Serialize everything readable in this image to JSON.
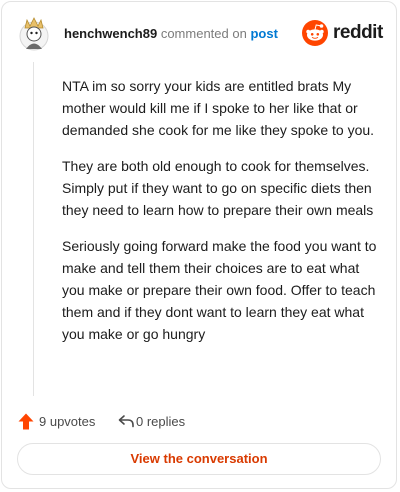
{
  "header": {
    "username": "henchwench89",
    "commented_on": "commented on",
    "post_link": "post",
    "brand": "reddit"
  },
  "comment": {
    "paragraphs": [
      "NTA im so sorry your kids are entitled brats My mother would kill me if I spoke to her like that or demanded she cook for me like they spoke to you.",
      "They are both old enough to cook for themselves. Simply put if they want to go on specific diets then they need to learn how to prepare their own meals",
      "Seriously going forward make the food you want to make and tell them their choices are to eat what you make or prepare their own food. Offer to teach them and if they dont want to learn they eat what you make or go hungry"
    ]
  },
  "actions": {
    "upvotes": "9 upvotes",
    "replies": "0 replies"
  },
  "cta": {
    "label": "View the conversation"
  },
  "colors": {
    "brand_orange": "#ff4500",
    "upvote": "#ff4500",
    "link_blue": "#0079d3",
    "cta_text": "#d93a00"
  },
  "icons": [
    "avatar",
    "reddit-logo-icon",
    "upvote-arrow-icon",
    "reply-icon"
  ]
}
